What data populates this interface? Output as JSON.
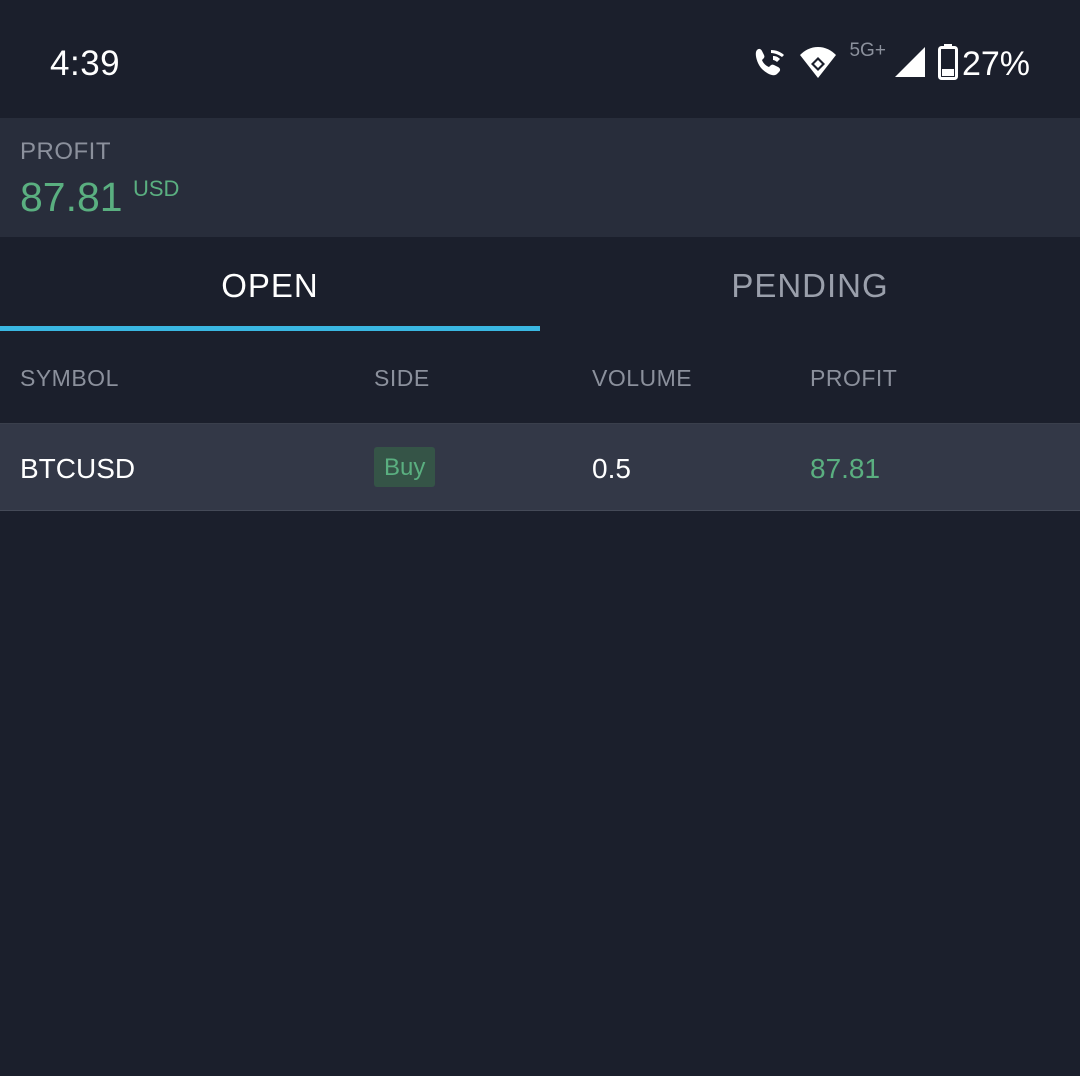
{
  "status_bar": {
    "time": "4:39",
    "network_label": "5G+",
    "battery_percent": "27%",
    "icons": [
      "wifi-call-icon",
      "wifi-icon",
      "cellular-signal-icon",
      "battery-icon"
    ]
  },
  "summary": {
    "label": "PROFIT",
    "value": "87.81",
    "currency": "USD"
  },
  "tabs": [
    {
      "label": "OPEN",
      "active": true
    },
    {
      "label": "PENDING",
      "active": false
    }
  ],
  "table": {
    "columns": [
      "SYMBOL",
      "SIDE",
      "VOLUME",
      "PROFIT"
    ],
    "rows": [
      {
        "symbol": "BTCUSD",
        "side": "Buy",
        "volume": "0.5",
        "profit": "87.81"
      }
    ]
  },
  "colors": {
    "background": "#1b1f2c",
    "summary_background": "#282d3b",
    "row_background": "#333847",
    "profit_green": "#5aaf80",
    "tab_indicator": "#3ab7e2"
  }
}
